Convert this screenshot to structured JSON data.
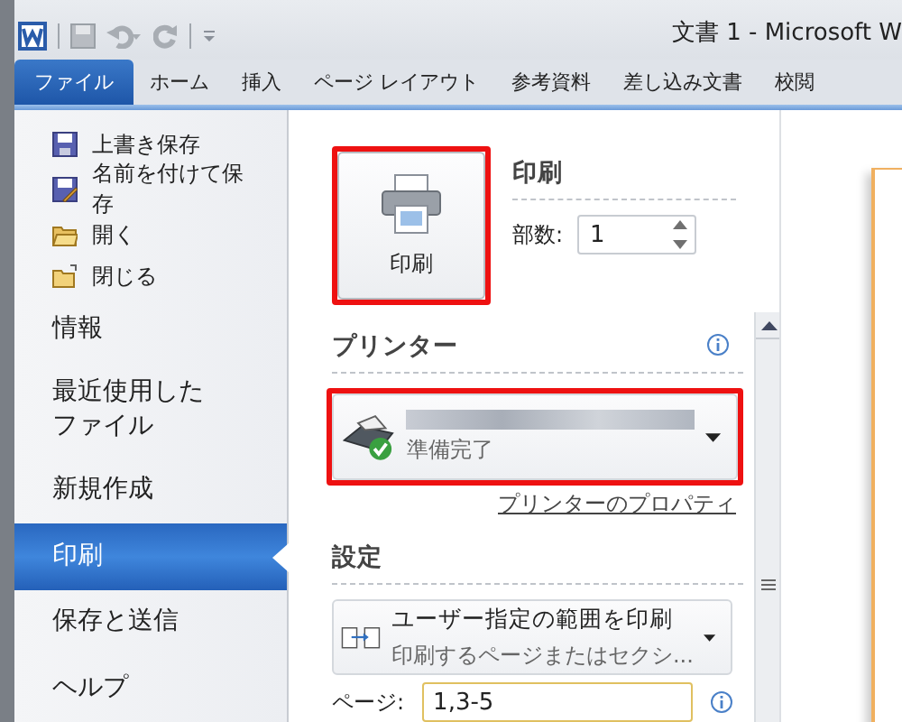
{
  "window": {
    "title": "文書 1 - Microsoft W"
  },
  "tabs": [
    {
      "label": "ファイル",
      "selected": true
    },
    {
      "label": "ホーム",
      "selected": false
    },
    {
      "label": "挿入",
      "selected": false
    },
    {
      "label": "ページ レイアウト",
      "selected": false
    },
    {
      "label": "参考資料",
      "selected": false
    },
    {
      "label": "差し込み文書",
      "selected": false
    },
    {
      "label": "校閲",
      "selected": false
    }
  ],
  "sidebar": {
    "items": [
      {
        "kind": "command",
        "label": "上書き保存",
        "selected": false
      },
      {
        "kind": "command",
        "label": "名前を付けて保存",
        "selected": false
      },
      {
        "kind": "command",
        "label": "開く",
        "selected": false
      },
      {
        "kind": "command",
        "label": "閉じる",
        "selected": false
      },
      {
        "kind": "section",
        "label": "情報",
        "selected": false
      },
      {
        "kind": "section",
        "label": "最近使用したファイル",
        "selected": false
      },
      {
        "kind": "section",
        "label": "新規作成",
        "selected": false
      },
      {
        "kind": "section",
        "label": "印刷",
        "selected": true
      },
      {
        "kind": "section",
        "label": "保存と送信",
        "selected": false
      },
      {
        "kind": "section",
        "label": "ヘルプ",
        "selected": false
      }
    ]
  },
  "print": {
    "heading": "印刷",
    "button": "印刷",
    "highlighted": true,
    "copies_label": "部数:",
    "copies": "1"
  },
  "printer": {
    "heading": "プリンター",
    "status": "準備完了",
    "highlighted": true,
    "properties_link": "プリンターのプロパティ"
  },
  "settings": {
    "heading": "設定",
    "range_title": "ユーザー指定の範囲を印刷",
    "range_subtitle": "印刷するページまたはセクシ...",
    "pages_label": "ページ:",
    "pages": "1,3-5"
  }
}
